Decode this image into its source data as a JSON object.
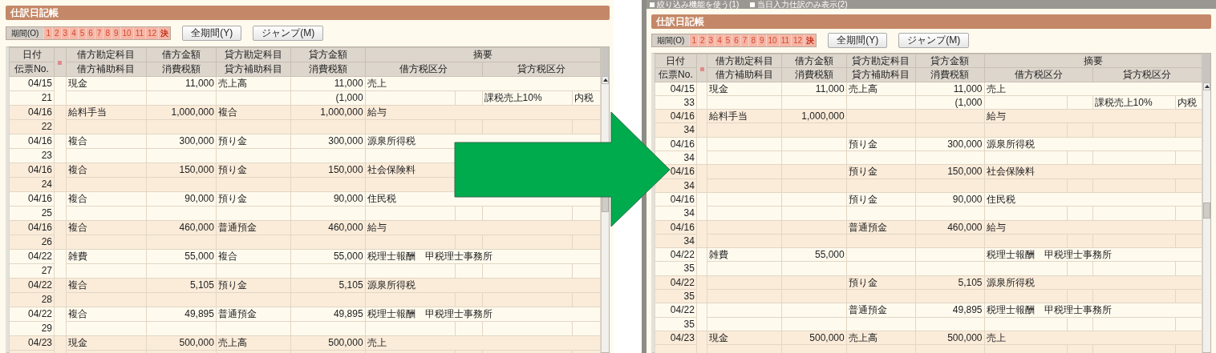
{
  "panels": [
    {
      "title": "仕訳日記帳",
      "period": {
        "label": "期間(O)",
        "months": [
          "1",
          "2",
          "3",
          "4",
          "5",
          "6",
          "7",
          "8",
          "9",
          "10",
          "11",
          "12",
          "決"
        ]
      },
      "buttons": [
        "全期間(Y)",
        "ジャンプ(M)"
      ],
      "header_top": [
        "日付",
        "借方勘定科目",
        "借方金額",
        "貸方勘定科目",
        "貸方金額",
        "摘要"
      ],
      "header_bottom": [
        "伝票No.",
        "借方補助科目",
        "消費税額",
        "貸方補助科目",
        "消費税額",
        "借方税区分",
        "貸方税区分"
      ],
      "entries": [
        {
          "date": "04/15",
          "voucher": "21",
          "debit_account": "現金",
          "debit_amount": "11,000",
          "credit_account": "売上高",
          "credit_amount": "11,000",
          "summary": "売上",
          "credit_tax": "(1,000",
          "credit_tax_category": "課税売上10%",
          "credit_tax_type": "内税"
        },
        {
          "date": "04/16",
          "voucher": "22",
          "debit_account": "給料手当",
          "debit_amount": "1,000,000",
          "credit_account": "複合",
          "credit_amount": "1,000,000",
          "summary": "給与"
        },
        {
          "date": "04/16",
          "voucher": "23",
          "debit_account": "複合",
          "debit_amount": "300,000",
          "credit_account": "預り金",
          "credit_amount": "300,000",
          "summary": "源泉所得税"
        },
        {
          "date": "04/16",
          "voucher": "24",
          "debit_account": "複合",
          "debit_amount": "150,000",
          "credit_account": "預り金",
          "credit_amount": "150,000",
          "summary": "社会保険料"
        },
        {
          "date": "04/16",
          "voucher": "25",
          "debit_account": "複合",
          "debit_amount": "90,000",
          "credit_account": "預り金",
          "credit_amount": "90,000",
          "summary": "住民税"
        },
        {
          "date": "04/16",
          "voucher": "26",
          "debit_account": "複合",
          "debit_amount": "460,000",
          "credit_account": "普通預金",
          "credit_amount": "460,000",
          "summary": "給与"
        },
        {
          "date": "04/22",
          "voucher": "27",
          "debit_account": "雑費",
          "debit_amount": "55,000",
          "credit_account": "複合",
          "credit_amount": "55,000",
          "summary": "税理士報酬　甲税理士事務所"
        },
        {
          "date": "04/22",
          "voucher": "28",
          "debit_account": "複合",
          "debit_amount": "5,105",
          "credit_account": "預り金",
          "credit_amount": "5,105",
          "summary": "源泉所得税"
        },
        {
          "date": "04/22",
          "voucher": "29",
          "debit_account": "複合",
          "debit_amount": "49,895",
          "credit_account": "普通預金",
          "credit_amount": "49,895",
          "summary": "税理士報酬　甲税理士事務所"
        },
        {
          "date": "04/23",
          "debit_account": "現金",
          "debit_amount": "500,000",
          "credit_account": "売上高",
          "credit_amount": "500,000",
          "summary": "売上"
        }
      ]
    },
    {
      "filter_options": [
        "絞り込み機能を使う(1)",
        "当日入力仕訳のみ表示(2)"
      ],
      "title": "仕訳日記帳",
      "period": {
        "label": "期間(O)",
        "months": [
          "1",
          "2",
          "3",
          "4",
          "5",
          "6",
          "7",
          "8",
          "9",
          "10",
          "11",
          "12",
          "決"
        ]
      },
      "buttons": [
        "全期間(Y)",
        "ジャンプ(M)"
      ],
      "header_top": [
        "日付",
        "借方勘定科目",
        "借方金額",
        "貸方勘定科目",
        "貸方金額",
        "摘要"
      ],
      "header_bottom": [
        "伝票No.",
        "借方補助科目",
        "消費税額",
        "貸方補助科目",
        "消費税額",
        "借方税区分",
        "貸方税区分"
      ],
      "entries": [
        {
          "date": "04/15",
          "voucher": "33",
          "debit_account": "現金",
          "debit_amount": "11,000",
          "credit_account": "売上高",
          "credit_amount": "11,000",
          "summary": "売上",
          "credit_tax": "(1,000",
          "credit_tax_category": "課税売上10%",
          "credit_tax_type": "内税"
        },
        {
          "date": "04/16",
          "voucher": "34",
          "debit_account": "給料手当",
          "debit_amount": "1,000,000",
          "summary": "給与"
        },
        {
          "date": "04/16",
          "voucher": "34",
          "credit_account": "預り金",
          "credit_amount": "300,000",
          "summary": "源泉所得税"
        },
        {
          "date": "04/16",
          "voucher": "34",
          "credit_account": "預り金",
          "credit_amount": "150,000",
          "summary": "社会保険料"
        },
        {
          "date": "04/16",
          "voucher": "34",
          "credit_account": "預り金",
          "credit_amount": "90,000",
          "summary": "住民税"
        },
        {
          "date": "04/16",
          "voucher": "34",
          "credit_account": "普通預金",
          "credit_amount": "460,000",
          "summary": "給与"
        },
        {
          "date": "04/22",
          "voucher": "35",
          "debit_account": "雑費",
          "debit_amount": "55,000",
          "summary": "税理士報酬　甲税理士事務所"
        },
        {
          "date": "04/22",
          "voucher": "35",
          "credit_account": "預り金",
          "credit_amount": "5,105",
          "summary": "源泉所得税"
        },
        {
          "date": "04/22",
          "voucher": "35",
          "credit_account": "普通預金",
          "credit_amount": "49,895",
          "summary": "税理士報酬　甲税理士事務所"
        },
        {
          "date": "04/23",
          "debit_account": "現金",
          "debit_amount": "500,000",
          "credit_account": "売上高",
          "credit_amount": "500,000",
          "summary": "売上"
        }
      ]
    }
  ]
}
